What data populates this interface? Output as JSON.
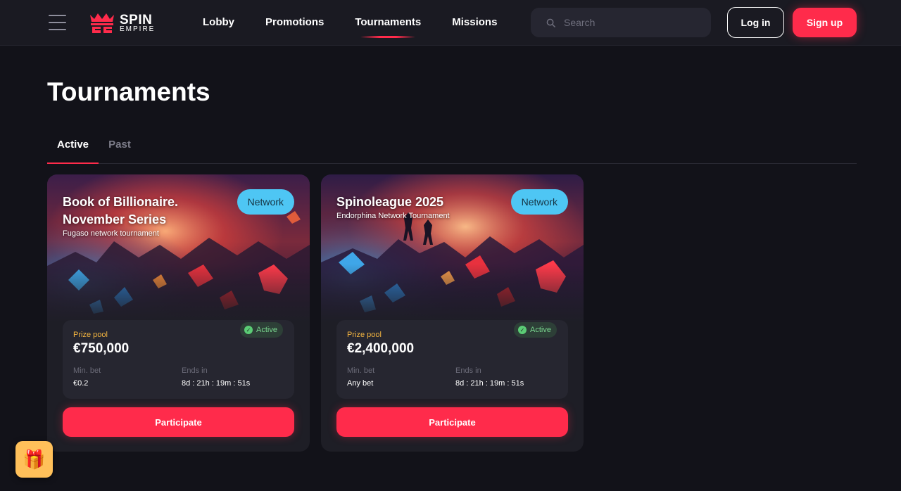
{
  "brand": {
    "name_line1": "SPIN",
    "name_line2": "EMPIRE",
    "accent": "#ff2b4b"
  },
  "header": {
    "nav": [
      {
        "label": "Lobby"
      },
      {
        "label": "Promotions"
      },
      {
        "label": "Tournaments",
        "active": true
      },
      {
        "label": "Missions"
      }
    ],
    "search": {
      "placeholder": "Search"
    },
    "login_label": "Log in",
    "signup_label": "Sign up"
  },
  "page": {
    "title": "Tournaments",
    "tabs": [
      {
        "label": "Active",
        "active": true
      },
      {
        "label": "Past",
        "active": false
      }
    ]
  },
  "tournaments": [
    {
      "title": "Book of Billionaire. November Series",
      "subtitle": "Fugaso network tournament",
      "badge": "Network",
      "status": "Active",
      "prize_label": "Prize pool",
      "prize": "€750,000",
      "min_bet_label": "Min. bet",
      "min_bet": "€0.2",
      "ends_label": "Ends in",
      "ends_in": "8d : 21h : 19m : 51s",
      "cta": "Participate"
    },
    {
      "title": "Spinoleague 2025",
      "subtitle": "Endorphina Network Tournament",
      "badge": "Network",
      "status": "Active",
      "prize_label": "Prize pool",
      "prize": "€2,400,000",
      "min_bet_label": "Min. bet",
      "min_bet": "Any bet",
      "ends_label": "Ends in",
      "ends_in": "8d : 21h : 19m : 51s",
      "cta": "Participate"
    }
  ],
  "icons": {
    "menu": "hamburger-icon",
    "search": "search-icon",
    "status": "check-circle-icon",
    "gift": "gift-icon"
  },
  "colors": {
    "background": "#121219",
    "header": "#1a1a22",
    "card": "#1e1e26",
    "network_badge": "#4ec6f4",
    "prize_label": "#f5b640",
    "status_green": "#5bcc75"
  }
}
